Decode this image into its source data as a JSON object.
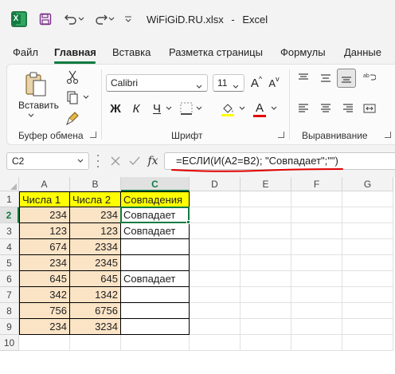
{
  "titlebar": {
    "filename": "WiFiGiD.RU.xlsx",
    "separator": "-",
    "app": "Excel"
  },
  "tabs": [
    "Файл",
    "Главная",
    "Вставка",
    "Разметка страницы",
    "Формулы",
    "Данные"
  ],
  "active_tab": "Главная",
  "ribbon": {
    "clipboard": {
      "paste_label": "Вставить",
      "group_label": "Буфер обмена"
    },
    "font": {
      "font_name": "Calibri",
      "font_size": "11",
      "bold": "Ж",
      "italic": "К",
      "underline": "Ч",
      "grow": "A",
      "shrink": "A",
      "font_color_letter": "A",
      "group_label": "Шрифт",
      "fill_color": "#ffff00",
      "font_color": "#e00000"
    },
    "alignment": {
      "group_label": "Выравнивание"
    }
  },
  "formula_bar": {
    "name_box": "C2",
    "fx": "fx",
    "formula": "=ЕСЛИ(И(A2=B2); \"Совпадает\";\"\")"
  },
  "grid": {
    "columns": [
      "A",
      "B",
      "C",
      "D",
      "E",
      "F",
      "G"
    ],
    "rows": [
      "1",
      "2",
      "3",
      "4",
      "5",
      "6",
      "7",
      "8",
      "9",
      "10"
    ],
    "header_row": [
      "Числа 1",
      "Числа 2",
      "Совпадения"
    ],
    "data": [
      [
        "234",
        "234",
        "Совпадает"
      ],
      [
        "123",
        "123",
        "Совпадает"
      ],
      [
        "674",
        "2334",
        ""
      ],
      [
        "234",
        "2345",
        ""
      ],
      [
        "645",
        "645",
        "Совпадает"
      ],
      [
        "342",
        "1342",
        ""
      ],
      [
        "756",
        "6756",
        ""
      ],
      [
        "234",
        "3234",
        ""
      ]
    ],
    "active_cell": "C2"
  },
  "colors": {
    "accent": "#107c41",
    "header_fill": "#ffff00",
    "data_fill": "#fbe4c6",
    "formula_underline": "#e00000"
  }
}
